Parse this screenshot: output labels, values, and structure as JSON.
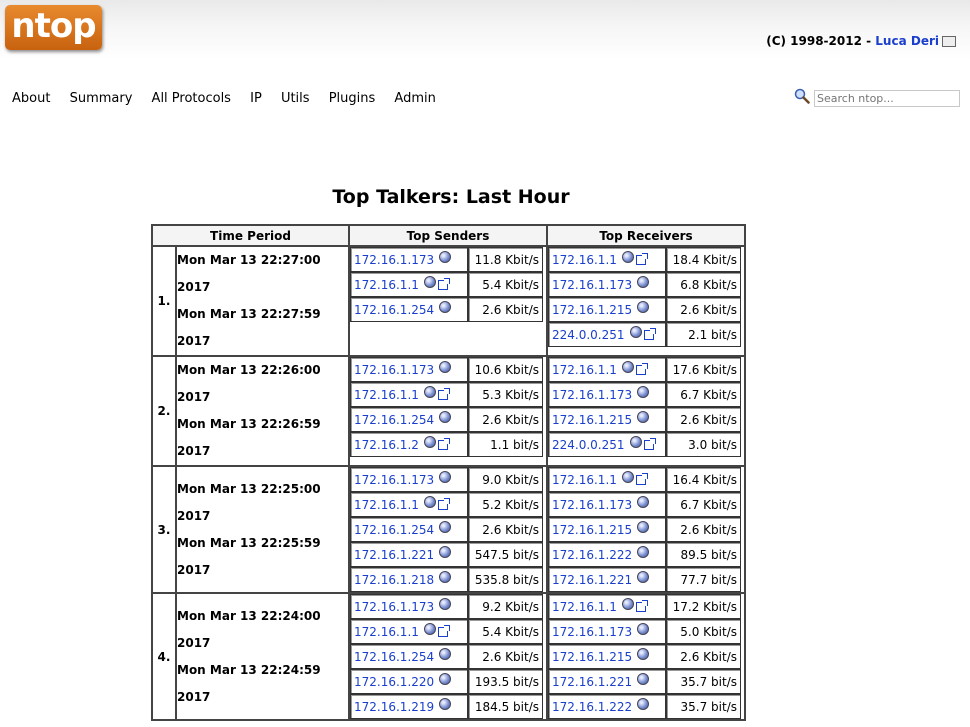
{
  "header": {
    "logo_text": "ntop",
    "copyright_prefix": "(C) 1998-2012 - ",
    "author_link": "Luca Deri"
  },
  "nav": [
    "About",
    "Summary",
    "All Protocols",
    "IP",
    "Utils",
    "Plugins",
    "Admin"
  ],
  "search": {
    "placeholder": "Search ntop..."
  },
  "page_title": "Top Talkers: Last Hour",
  "table": {
    "headers": {
      "period": "Time Period",
      "senders": "Top Senders",
      "receivers": "Top Receivers"
    },
    "rows": [
      {
        "rank": "1.",
        "start": "Mon Mar 13 22:27:00 2017",
        "end": "Mon Mar 13 22:27:59 2017",
        "senders": [
          {
            "host": "172.16.1.173",
            "rate": "11.8 Kbit/s",
            "ext": false
          },
          {
            "host": "172.16.1.1",
            "rate": "5.4 Kbit/s",
            "ext": true
          },
          {
            "host": "172.16.1.254",
            "rate": "2.6 Kbit/s",
            "ext": false
          }
        ],
        "receivers": [
          {
            "host": "172.16.1.1",
            "rate": "18.4 Kbit/s",
            "ext": true
          },
          {
            "host": "172.16.1.173",
            "rate": "6.8 Kbit/s",
            "ext": false
          },
          {
            "host": "172.16.1.215",
            "rate": "2.6 Kbit/s",
            "ext": false
          },
          {
            "host": "224.0.0.251",
            "rate": "2.1 bit/s",
            "ext": true
          }
        ]
      },
      {
        "rank": "2.",
        "start": "Mon Mar 13 22:26:00 2017",
        "end": "Mon Mar 13 22:26:59 2017",
        "senders": [
          {
            "host": "172.16.1.173",
            "rate": "10.6 Kbit/s",
            "ext": false
          },
          {
            "host": "172.16.1.1",
            "rate": "5.3 Kbit/s",
            "ext": true
          },
          {
            "host": "172.16.1.254",
            "rate": "2.6 Kbit/s",
            "ext": false
          },
          {
            "host": "172.16.1.2",
            "rate": "1.1 bit/s",
            "ext": true
          }
        ],
        "receivers": [
          {
            "host": "172.16.1.1",
            "rate": "17.6 Kbit/s",
            "ext": true
          },
          {
            "host": "172.16.1.173",
            "rate": "6.7 Kbit/s",
            "ext": false
          },
          {
            "host": "172.16.1.215",
            "rate": "2.6 Kbit/s",
            "ext": false
          },
          {
            "host": "224.0.0.251",
            "rate": "3.0 bit/s",
            "ext": true
          }
        ]
      },
      {
        "rank": "3.",
        "start": "Mon Mar 13 22:25:00 2017",
        "end": "Mon Mar 13 22:25:59 2017",
        "senders": [
          {
            "host": "172.16.1.173",
            "rate": "9.0 Kbit/s",
            "ext": false
          },
          {
            "host": "172.16.1.1",
            "rate": "5.2 Kbit/s",
            "ext": true
          },
          {
            "host": "172.16.1.254",
            "rate": "2.6 Kbit/s",
            "ext": false
          },
          {
            "host": "172.16.1.221",
            "rate": "547.5 bit/s",
            "ext": false
          },
          {
            "host": "172.16.1.218",
            "rate": "535.8 bit/s",
            "ext": false
          }
        ],
        "receivers": [
          {
            "host": "172.16.1.1",
            "rate": "16.4 Kbit/s",
            "ext": true
          },
          {
            "host": "172.16.1.173",
            "rate": "6.7 Kbit/s",
            "ext": false
          },
          {
            "host": "172.16.1.215",
            "rate": "2.6 Kbit/s",
            "ext": false
          },
          {
            "host": "172.16.1.222",
            "rate": "89.5 bit/s",
            "ext": false
          },
          {
            "host": "172.16.1.221",
            "rate": "77.7 bit/s",
            "ext": false
          }
        ]
      },
      {
        "rank": "4.",
        "start": "Mon Mar 13 22:24:00 2017",
        "end": "Mon Mar 13 22:24:59 2017",
        "senders": [
          {
            "host": "172.16.1.173",
            "rate": "9.2 Kbit/s",
            "ext": false
          },
          {
            "host": "172.16.1.1",
            "rate": "5.4 Kbit/s",
            "ext": true
          },
          {
            "host": "172.16.1.254",
            "rate": "2.6 Kbit/s",
            "ext": false
          },
          {
            "host": "172.16.1.220",
            "rate": "193.5 bit/s",
            "ext": false
          },
          {
            "host": "172.16.1.219",
            "rate": "184.5 bit/s",
            "ext": false
          }
        ],
        "receivers": [
          {
            "host": "172.16.1.1",
            "rate": "17.2 Kbit/s",
            "ext": true
          },
          {
            "host": "172.16.1.173",
            "rate": "5.0 Kbit/s",
            "ext": false
          },
          {
            "host": "172.16.1.215",
            "rate": "2.6 Kbit/s",
            "ext": false
          },
          {
            "host": "172.16.1.221",
            "rate": "35.7 bit/s",
            "ext": false
          },
          {
            "host": "172.16.1.222",
            "rate": "35.7 bit/s",
            "ext": false
          }
        ]
      }
    ]
  }
}
